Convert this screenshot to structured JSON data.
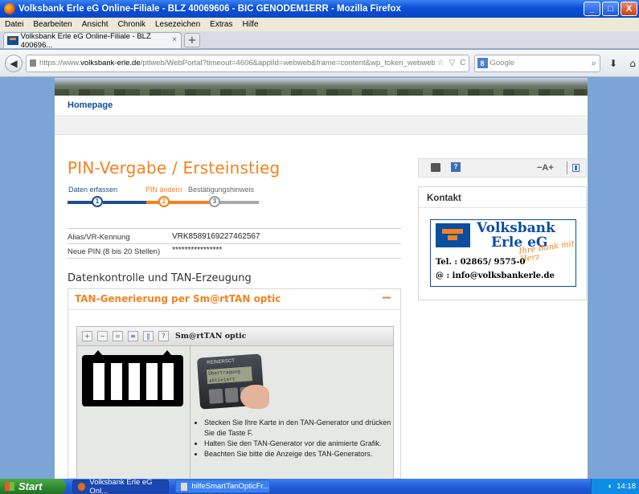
{
  "window": {
    "title": "Volksbank Erle eG Online-Filiale - BLZ 40069606 - BIC GENODEM1ERR - Mozilla Firefox",
    "buttons": [
      "_",
      "□",
      "X"
    ]
  },
  "menu": [
    "Datei",
    "Bearbeiten",
    "Ansicht",
    "Chronik",
    "Lesezeichen",
    "Extras",
    "Hilfe"
  ],
  "tab": {
    "label": "Volksbank Erle eG Online-Filiale - BLZ 400696...",
    "close": "×",
    "new": "+"
  },
  "nav": {
    "url_prefix": "https://www.",
    "url_domain": "volksbank-erle.de",
    "url_path": "/ptlweb/WebPortal?timeout=4606&applId=webweb&frame=content&wp_token_webweb=43131",
    "search_placeholder": "Google",
    "search_engine_badge": "8"
  },
  "site": {
    "nav_home": "Homepage",
    "page_title": "PIN-Vergabe / Ersteinstieg",
    "steps": [
      {
        "label": "Daten erfassen",
        "number": "1"
      },
      {
        "label": "PIN ändern",
        "number": "2"
      },
      {
        "label": "Bestätigungshinweis",
        "number": "3"
      }
    ],
    "fields": [
      {
        "label": "Alias/VR-Kennung",
        "value": "VRK8589169227462567"
      },
      {
        "label": "Neue PIN (8 bis 20 Stellen)",
        "value": "****************"
      }
    ],
    "section_title": "Datenkontrolle und TAN-Erzeugung",
    "accordion_title": "TAN-Generierung per Sm@rtTAN optic",
    "accordion_toggle": "−",
    "applet": {
      "title": "Sm@rtTAN optic",
      "device_brand": "REINERSCT",
      "device_screen": "Übertragung aktiviert",
      "instructions": [
        "Stecken Sie Ihre Karte in den TAN-Generator und drücken Sie die Taste F.",
        "Halten Sie den TAN-Generator vor die animierte Grafik.",
        "Beachten Sie bitte die Anzeige des TAN-Generators."
      ]
    },
    "toolbox": {
      "font_size": "−A+"
    },
    "contact": {
      "title": "Kontakt",
      "bank_name_1": "Volksbank",
      "bank_name_2": "Erle eG",
      "slogan": "Ihre Bank mit Herz",
      "phone": "Tel. : 02865/ 9575-0",
      "email": "@    : info@volksbankerle.de"
    }
  },
  "taskbar": {
    "start": "Start",
    "tasks": [
      "Volksbank Erle eG Onl...",
      "hilfeSmartTanOpticFr..."
    ],
    "clock": "14:18"
  },
  "colors": {
    "accent_orange": "#f58220",
    "brand_blue": "#0a4ea0",
    "step_blue": "#1f4f8a"
  }
}
